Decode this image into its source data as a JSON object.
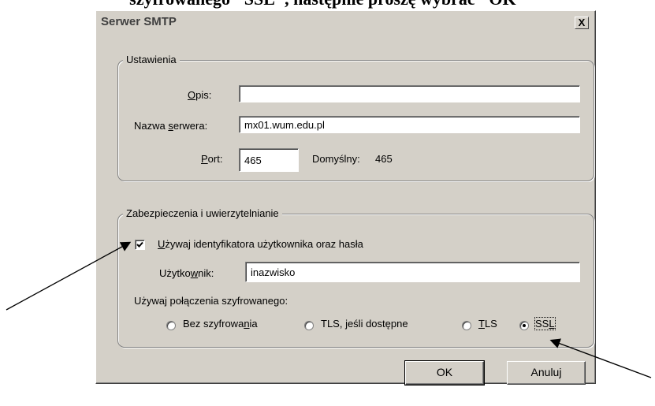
{
  "document_text": "szyfrowanego \"SSL\", następnie proszę wybrać \"OK\"",
  "dialog": {
    "title": "Serwer SMTP",
    "close_label": "X"
  },
  "settings": {
    "legend": "Ustawienia",
    "description_label_u": "O",
    "description_label_rest": "pis:",
    "description_value": "",
    "server_label_pre": "Nazwa ",
    "server_label_u": "s",
    "server_label_rest": "erwera:",
    "server_value": "mx01.wum.edu.pl",
    "port_label_u": "P",
    "port_label_rest": "ort:",
    "port_value": "465",
    "default_label": "Domyślny:",
    "default_value": "465"
  },
  "security": {
    "legend": "Zabezpieczenia i uwierzytelnianie",
    "use_auth_u": "U",
    "use_auth_rest": "żywaj identyfikatora użytkownika oraz hasła",
    "use_auth_checked": true,
    "user_label_pre": "Użytko",
    "user_label_u": "w",
    "user_label_rest": "nik:",
    "user_value": "inazwisko",
    "encryption_label": "Używaj połączenia szyfrowanego:",
    "options": [
      {
        "pre": "Bez szyfrowa",
        "u": "n",
        "rest": "ia",
        "selected": false
      },
      {
        "pre": "TLS, jeśli dostępne",
        "u": "",
        "rest": "",
        "selected": false
      },
      {
        "pre": "",
        "u": "T",
        "rest": "LS",
        "selected": false
      },
      {
        "pre": "SS",
        "u": "L",
        "rest": "",
        "selected": true
      }
    ]
  },
  "buttons": {
    "ok": "OK",
    "cancel": "Anuluj"
  }
}
